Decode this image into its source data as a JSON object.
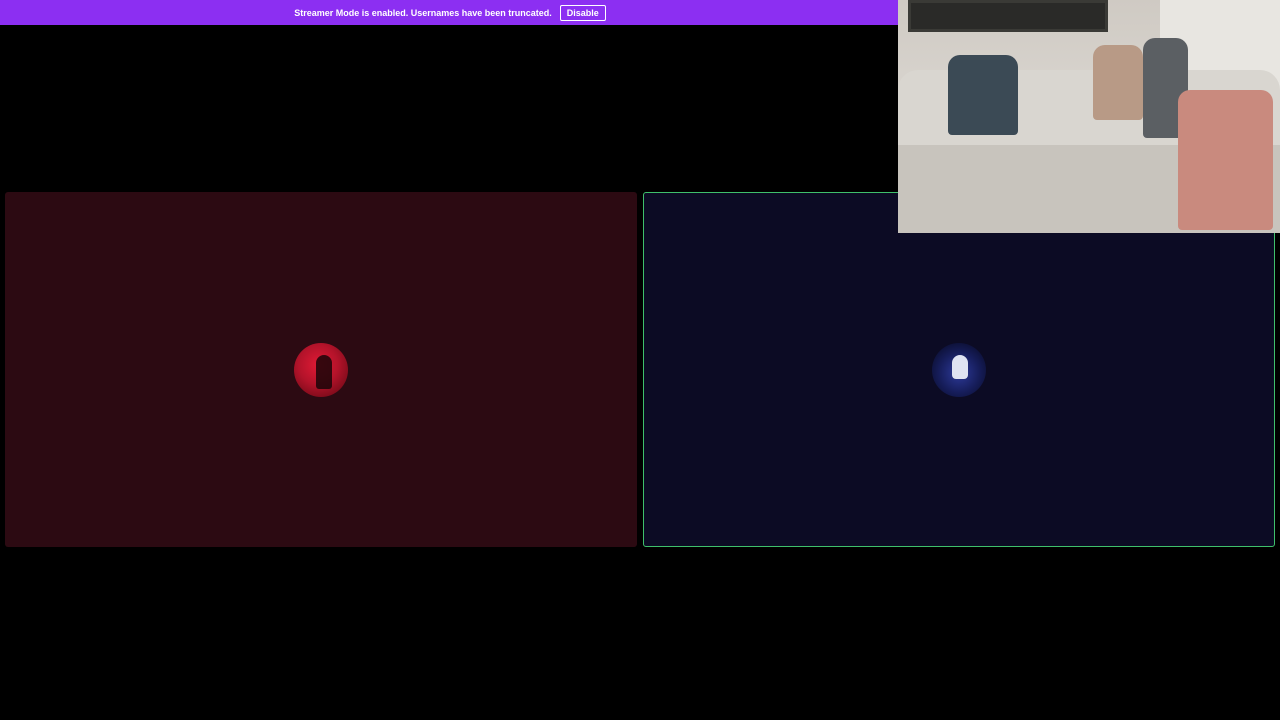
{
  "banner": {
    "message": "Streamer Mode is enabled. Usernames have been truncated.",
    "disable_label": "Disable"
  },
  "tiles": [
    {
      "id": "left",
      "theme_color": "#2c0a12",
      "avatar_icon": "red-moon-avatar-icon",
      "speaking": false
    },
    {
      "id": "right",
      "theme_color": "#0c0b24",
      "avatar_icon": "blue-character-avatar-icon",
      "speaking": true,
      "speaking_border_color": "#3fbf6b"
    }
  ],
  "webcam": {
    "icon": "webcam-video-feed"
  },
  "colors": {
    "banner_bg": "#8c2ff2",
    "page_bg": "#000000"
  }
}
